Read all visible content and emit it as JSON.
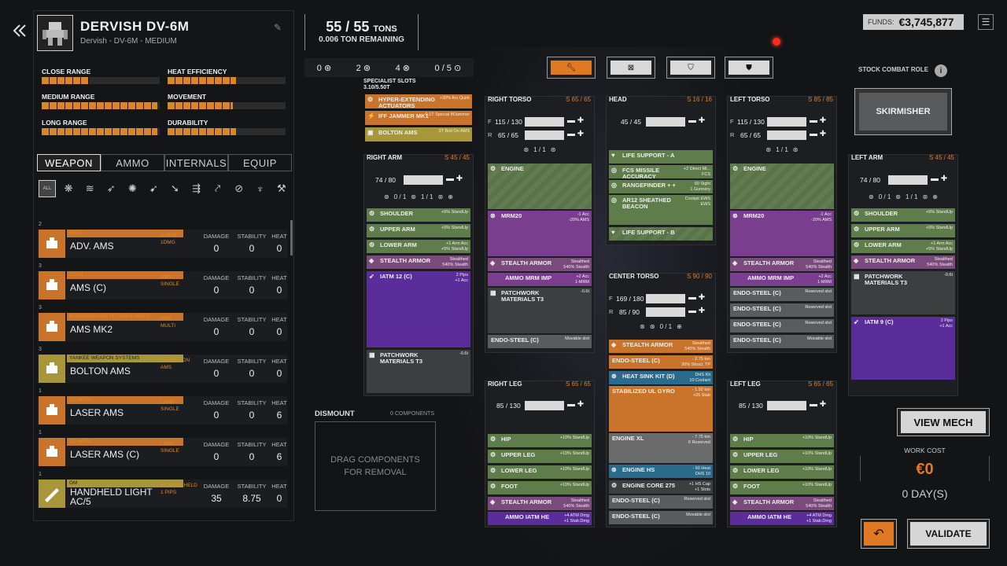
{
  "header": {
    "back_icon": "chevrons-left-icon",
    "mech_name": "DERVISH DV-6M",
    "mech_sub": "Dervish - DV-6M - MEDIUM"
  },
  "stats": [
    {
      "label": "CLOSE RANGE",
      "fraction": 0.4
    },
    {
      "label": "HEAT EFFICIENCY",
      "fraction": 0.58
    },
    {
      "label": "MEDIUM RANGE",
      "fraction": 0.98
    },
    {
      "label": "MOVEMENT",
      "fraction": 0.55
    },
    {
      "label": "LONG RANGE",
      "fraction": 0.98
    },
    {
      "label": "DURABILITY",
      "fraction": 0.58
    }
  ],
  "tabs": [
    "WEAPON",
    "AMMO",
    "INTERNALS",
    "EQUIP"
  ],
  "filter_all": "ALL",
  "weapons": [
    {
      "count": "2",
      "mfr": "RISC",
      "name": "ADV. AMS",
      "type": "A-AMS\n1DMG",
      "damage": "0",
      "stability": "0",
      "heat": "0"
    },
    {
      "count": "3",
      "mfr": "CLAN",
      "name": "AMS (C)",
      "type": "AMS\nSINGLE",
      "damage": "0",
      "stability": "0",
      "heat": "0"
    },
    {
      "count": "3",
      "mfr": "BLANKENBURG TECHNOLOGIES",
      "name": "AMS MK2",
      "type": "AMS\nMULTI",
      "damage": "0",
      "stability": "0",
      "heat": "0"
    },
    {
      "count": "3",
      "mfr": "YANKEE WEAPON SYSTEMS",
      "name": "BOLTON AMS",
      "type": "3T BOLT ON\nAMS",
      "damage": "0",
      "stability": "0",
      "heat": "0"
    },
    {
      "count": "1",
      "mfr": "DS AERO",
      "name": "LASER AMS",
      "type": "LAMS\nSINGLE",
      "damage": "0",
      "stability": "0",
      "heat": "6"
    },
    {
      "count": "1",
      "mfr": "DS AERO",
      "name": "LASER AMS (C)",
      "type": "LAMS\nSINGLE",
      "damage": "0",
      "stability": "0",
      "heat": "6"
    },
    {
      "count": "1",
      "mfr": "GM",
      "name": "HANDHELD LIGHT\nAC/5",
      "type": "6T HAND HELD\n1 PIPS",
      "damage": "35",
      "stability": "8.75",
      "heat": "0"
    }
  ],
  "col_headers": {
    "damage": "DAMAGE",
    "stability": "STABILITY",
    "heat": "HEAT"
  },
  "tonnage": {
    "current": "55",
    "max": "55",
    "unit": "TONS",
    "remaining": "0.006 TON REMAINING"
  },
  "hardpoints": [
    "0",
    "2",
    "4",
    "0 / 5"
  ],
  "funds": {
    "label": "FUNDS:",
    "value": "€3,745,877"
  },
  "combat_role": {
    "label": "STOCK COMBAT ROLE",
    "value": "SKIRMISHER"
  },
  "specialist": {
    "title": "SPECIALIST SLOTS",
    "sub": "3.10/5.50T",
    "items": [
      {
        "name": "HYPER-EXTENDING ACTUATORS",
        "desc": "+30% Arc Quirk"
      },
      {
        "name": "IFF JAMMER MK1",
        "desc": "0.1T Special IffJammer"
      },
      {
        "name": "BOLTON AMS",
        "desc": "3T Bolt On AMS"
      }
    ]
  },
  "sections": {
    "right_torso": {
      "title": "RIGHT TORSO",
      "slots": "S 65 / 65",
      "front": "115 / 130",
      "rear": "65 / 65",
      "heatsinks": "1 / 1"
    },
    "head": {
      "title": "HEAD",
      "slots": "S 16 / 16",
      "armor": "45 / 45"
    },
    "left_torso": {
      "title": "LEFT TORSO",
      "slots": "S 85 / 85",
      "front": "115 / 130",
      "rear": "65 / 65",
      "heatsinks": "1 / 1"
    },
    "right_arm": {
      "title": "RIGHT ARM",
      "slots": "S 45 / 45",
      "armor": "74 / 80",
      "hs1": "0 / 1",
      "hs2": "1 / 1"
    },
    "left_arm": {
      "title": "LEFT ARM",
      "slots": "S 45 / 45",
      "armor": "74 / 80",
      "hs1": "0 / 1",
      "hs2": "1 / 1"
    },
    "center_torso": {
      "title": "CENTER TORSO",
      "slots": "S 90 / 90",
      "front": "169 / 180",
      "rear": "85 / 90",
      "heatsinks": "0 / 1"
    },
    "right_leg": {
      "title": "RIGHT LEG",
      "slots": "S 65 / 65",
      "armor": "85 / 130"
    },
    "left_leg": {
      "title": "LEFT LEG",
      "slots": "S 65 / 65",
      "armor": "85 / 130"
    }
  },
  "components": {
    "rt": [
      {
        "n": "ENGINE",
        "d": ""
      },
      {
        "n": "MRM20",
        "d": "-1 Acc\n-20% AMS"
      },
      {
        "n": "STEALTH ARMOR",
        "d": "Stealthed\n540% Stealth"
      },
      {
        "n": "AMMO MRM IMP",
        "d": "+2 Acc\n1-MRM"
      },
      {
        "n": "PATCHWORK MATERIALS T3",
        "d": "-0.6t"
      },
      {
        "n": "ENDO-STEEL (C)",
        "d": "Movable slot"
      }
    ],
    "head": [
      {
        "n": "LIFE SUPPORT - A",
        "d": ""
      },
      {
        "n": "FCS MISSILE ACCURACY",
        "d": "+2 Direct Mi...\nFCS"
      },
      {
        "n": "RANGEFINDER + +",
        "d": "60 Sight\n1 Gunnery"
      },
      {
        "n": "AR12 SHEATHED BEACON",
        "d": "Cockpit EWS\nEWS"
      },
      {
        "n": "LIFE SUPPORT - B",
        "d": ""
      }
    ],
    "lt": [
      {
        "n": "ENGINE",
        "d": ""
      },
      {
        "n": "MRM20",
        "d": "-1 Acc\n-20% AMS"
      },
      {
        "n": "STEALTH ARMOR",
        "d": "Stealthed\n540% Stealth"
      },
      {
        "n": "AMMO MRM IMP",
        "d": "+2 Acc\n1-MRM"
      },
      {
        "n": "ENDO-STEEL (C)",
        "d": "Reserved slot"
      },
      {
        "n": "ENDO-STEEL (C)",
        "d": "Reserved slot"
      },
      {
        "n": "ENDO-STEEL (C)",
        "d": "Reserved slot"
      },
      {
        "n": "ENDO-STEEL (C)",
        "d": "Movable slot"
      }
    ],
    "ra": [
      {
        "n": "SHOULDER",
        "d": "+5% StandUp"
      },
      {
        "n": "UPPER ARM",
        "d": "+5% StandUp"
      },
      {
        "n": "LOWER ARM",
        "d": "+1 Arm Acc\n+5% StandUp"
      },
      {
        "n": "STEALTH ARMOR",
        "d": "Stealthed\n540% Stealth"
      },
      {
        "n": "IATM 12 (C)",
        "d": "2 Pips\n+1 Acc"
      },
      {
        "n": "PATCHWORK MATERIALS T3",
        "d": "-0.6t"
      }
    ],
    "la": [
      {
        "n": "SHOULDER",
        "d": "+5% StandUp"
      },
      {
        "n": "UPPER ARM",
        "d": "+5% StandUp"
      },
      {
        "n": "LOWER ARM",
        "d": "+1 Arm Acc\n+5% StandUp"
      },
      {
        "n": "STEALTH ARMOR",
        "d": "Stealthed\n540% Stealth"
      },
      {
        "n": "PATCHWORK MATERIALS T3",
        "d": "-0.6t"
      },
      {
        "n": "IATM 9 (C)",
        "d": "2 Pips\n+1 Acc"
      }
    ],
    "ct": [
      {
        "n": "STEALTH ARMOR",
        "d": "Stealthed\n540% Stealth"
      },
      {
        "n": "ENDO-STEEL (C)",
        "d": "- 2.75 ton\n30% Struct. TP"
      },
      {
        "n": "HEAT SINK KIT (D)",
        "d": "DHS Kit\n10 Coolant"
      },
      {
        "n": "STABILIZED UL GYRO",
        "d": "- 1.92 ton\n+25 Stab"
      },
      {
        "n": "ENGINE XL",
        "d": "- 7.75 ton\n6 Reserved"
      },
      {
        "n": "ENGINE HS",
        "d": "- 60 Heat\nDHS 10"
      },
      {
        "n": "ENGINE CORE 275",
        "d": "+1 HS Cap\n+1 Slots"
      },
      {
        "n": "ENDO-STEEL (C)",
        "d": "Reserved slot"
      },
      {
        "n": "ENDO-STEEL (C)",
        "d": "Movable slot"
      }
    ],
    "rl": [
      {
        "n": "HIP",
        "d": "+10% StandUp"
      },
      {
        "n": "UPPER LEG",
        "d": "+10% StandUp"
      },
      {
        "n": "LOWER LEG",
        "d": "+10% StandUp"
      },
      {
        "n": "FOOT",
        "d": "+10% StandUp"
      },
      {
        "n": "STEALTH ARMOR",
        "d": "Stealthed\n540% Stealth"
      },
      {
        "n": "AMMO IATM HE",
        "d": "+4 ATM Dmg\n+1 Stab.Dmg"
      }
    ],
    "ll": [
      {
        "n": "HIP",
        "d": "+10% StandUp"
      },
      {
        "n": "UPPER LEG",
        "d": "+10% StandUp"
      },
      {
        "n": "LOWER LEG",
        "d": "+10% StandUp"
      },
      {
        "n": "FOOT",
        "d": "+10% StandUp"
      },
      {
        "n": "STEALTH ARMOR",
        "d": "Stealthed\n540% Stealth"
      },
      {
        "n": "AMMO IATM HE",
        "d": "+4 ATM Dmg\n+1 Stab.Dmg"
      }
    ]
  },
  "dismount": {
    "title": "DISMOUNT",
    "count": "0 COMPONENTS",
    "hint": "DRAG COMPONENTS\nFOR REMOVAL"
  },
  "buttons": {
    "view_mech": "VIEW MECH",
    "validate": "VALIDATE"
  },
  "work_cost": {
    "label": "WORK COST",
    "value": "€0",
    "days": "0 DAY(S)"
  },
  "armor_labels": {
    "front": "F",
    "rear": "R"
  },
  "colors": {
    "accent": "#e07824",
    "structure": "#5f7d4a",
    "stealth": "#7a3e8f",
    "weapon": "#5a2d9a"
  }
}
